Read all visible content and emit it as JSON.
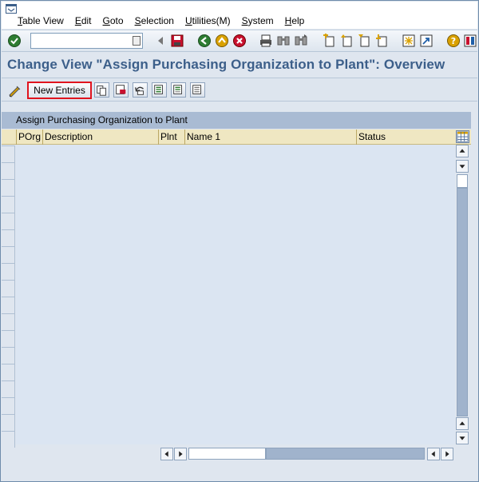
{
  "menu": {
    "items": [
      {
        "key": "T",
        "rest": "able View"
      },
      {
        "key": "E",
        "rest": "dit"
      },
      {
        "key": "G",
        "rest": "oto"
      },
      {
        "key": "S",
        "rest": "election"
      },
      {
        "key": "U",
        "rest": "tilities(M)"
      },
      {
        "key": "S",
        "rest": "ystem"
      },
      {
        "key": "H",
        "rest": "elp"
      }
    ]
  },
  "toolbar": {
    "command_value": "",
    "icons": [
      "enter-icon",
      "back-icon",
      "save-icon",
      "back-icon",
      "exit-icon",
      "cancel-icon",
      "print-icon",
      "find-icon",
      "find-next-icon",
      "first-page-icon",
      "previous-page-icon",
      "next-page-icon",
      "last-page-icon",
      "create-session-icon",
      "shortcut-icon",
      "help-icon",
      "customize-layout-icon"
    ]
  },
  "page": {
    "title": "Change View \"Assign Purchasing Organization to Plant\": Overview"
  },
  "app_toolbar": {
    "new_entries_label": "New Entries",
    "icons": [
      "edit-icon",
      "copy-as-icon",
      "delete-icon",
      "undo-icon",
      "select-all-icon",
      "select-block-icon",
      "deselect-all-icon"
    ]
  },
  "table": {
    "title": "Assign Purchasing Organization to Plant",
    "columns": [
      "POrg",
      "Description",
      "Plnt",
      "Name 1",
      "Status"
    ],
    "rows": []
  }
}
